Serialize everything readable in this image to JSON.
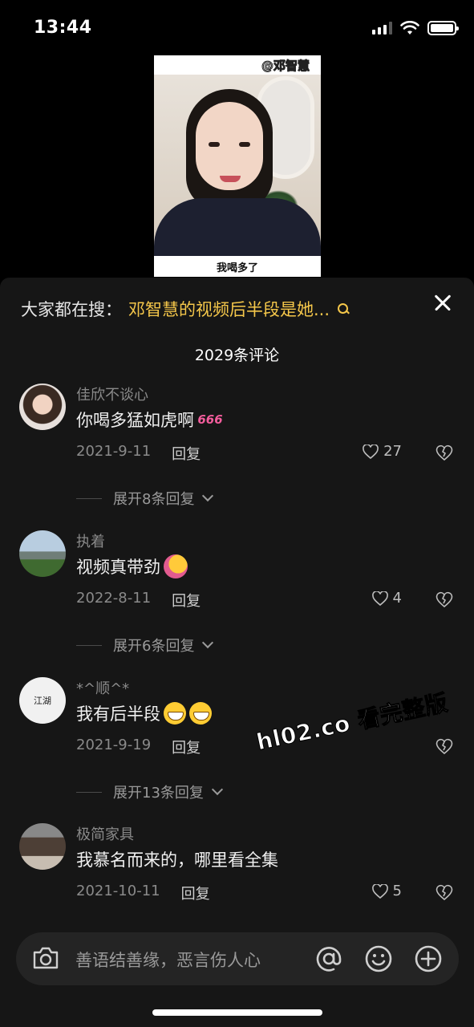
{
  "status_bar": {
    "time": "13:44",
    "battery_level": 1.0
  },
  "video": {
    "watermark": "@邓智慧",
    "caption": "我喝多了"
  },
  "sheet": {
    "search_prefix": "大家都在搜：",
    "search_term": "邓智慧的视频后半段是她...",
    "close_icon": "close-icon",
    "comment_count": "2029条评论"
  },
  "comments": [
    {
      "username": "佳欣不谈心",
      "text": "你喝多猛如虎啊",
      "emoji": "666",
      "date": "2021-9-11",
      "reply_label": "回复",
      "likes": "27",
      "expand_label": "展开8条回复"
    },
    {
      "username": "执着",
      "text": "视频真带劲",
      "emoji": "thumbs-up",
      "date": "2022-8-11",
      "reply_label": "回复",
      "likes": "4",
      "expand_label": "展开6条回复"
    },
    {
      "username": "*^顺^*",
      "avatar_text": "江湖",
      "text": "我有后半段",
      "emoji": "grin-grin",
      "date": "2021-9-19",
      "reply_label": "回复",
      "likes": "",
      "expand_label": "展开13条回复"
    },
    {
      "username": "极简家具",
      "text": "我慕名而来的，哪里看全集",
      "date": "2021-10-11",
      "reply_label": "回复",
      "likes": "5"
    }
  ],
  "overlay_watermark": "hl02.co 看完整版",
  "input": {
    "placeholder": "善语结善缘，恶言伤人心",
    "icons": [
      "camera-icon",
      "at-icon",
      "emoji-icon",
      "plus-icon"
    ]
  },
  "colors": {
    "background": "#161616",
    "accent": "#f5c74a",
    "muted": "#8a8a8a"
  }
}
